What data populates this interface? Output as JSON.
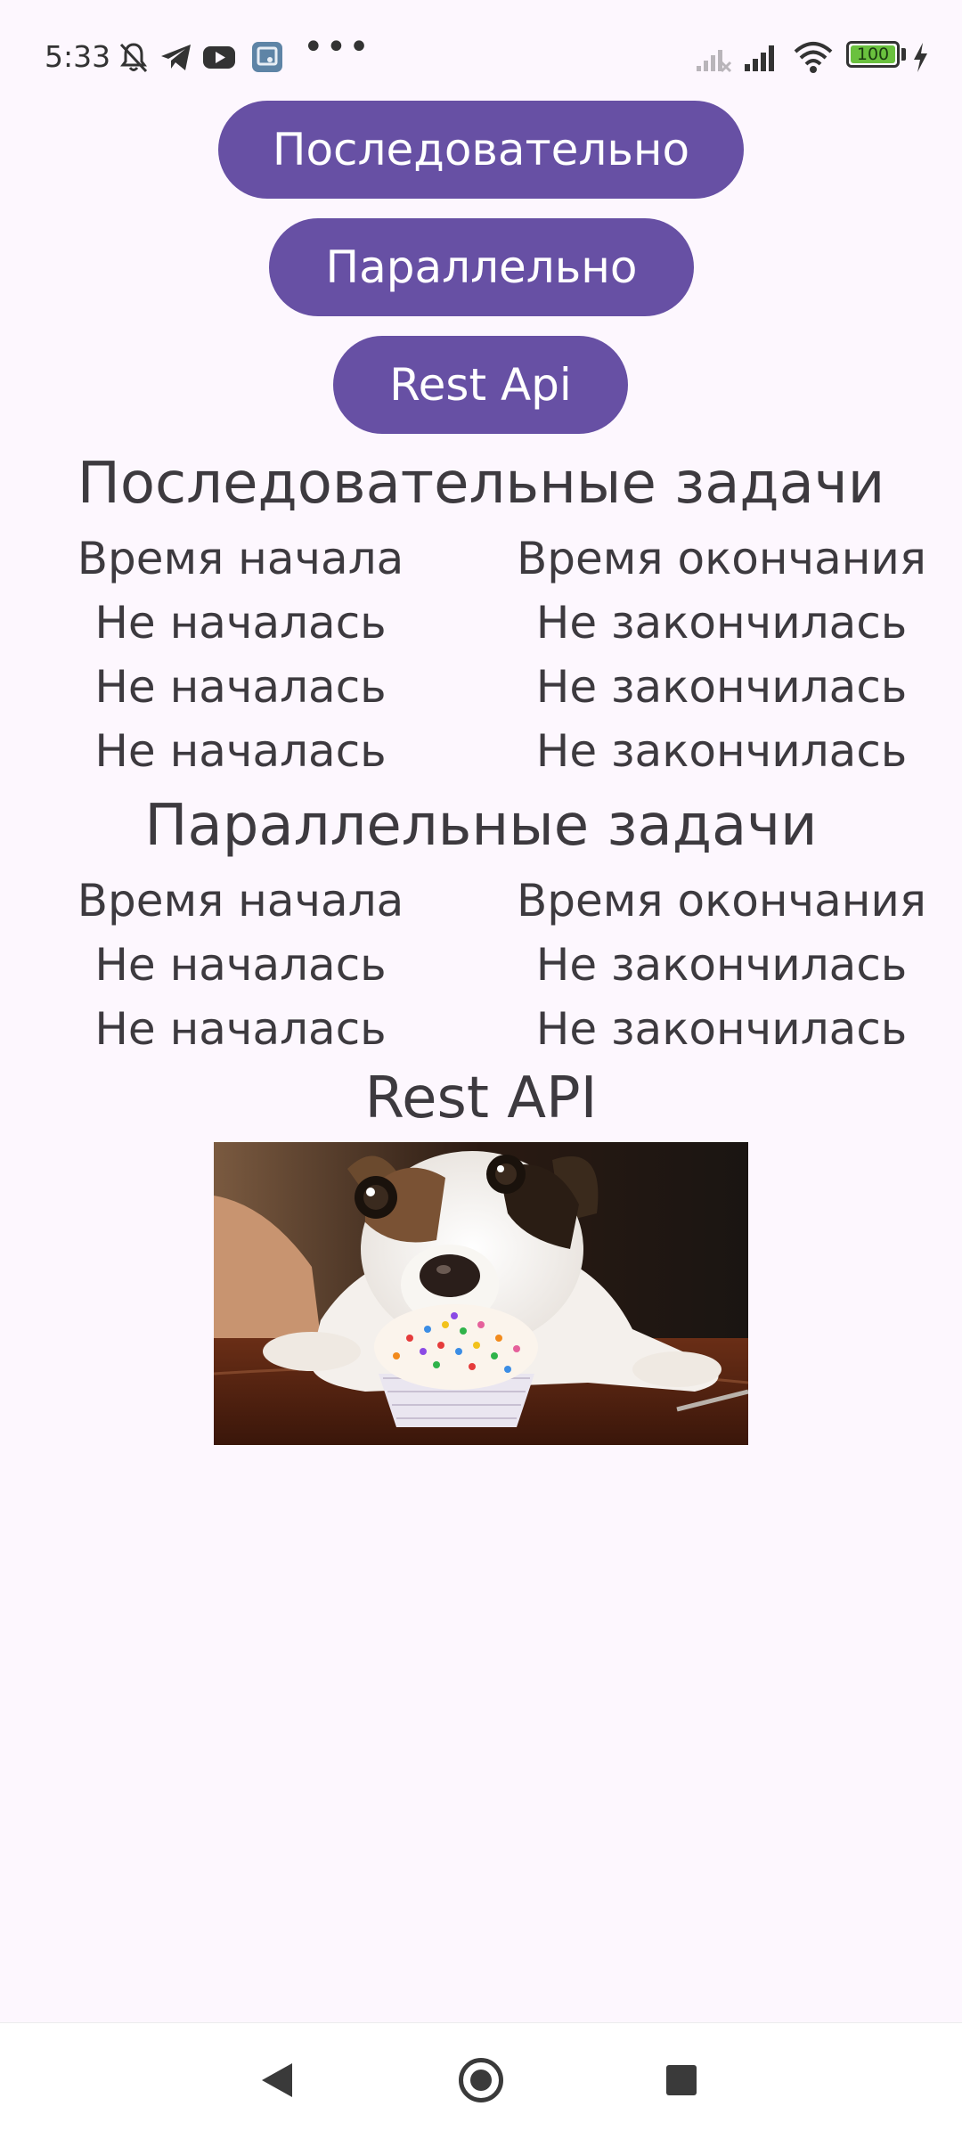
{
  "status_bar": {
    "time": "5:33",
    "battery": "100",
    "battery_level": 1.0,
    "icons": [
      "mute-bell-icon",
      "telegram-icon",
      "youtube-icon",
      "app-icon",
      "more-dots-icon",
      "signal-icon",
      "signal-icon-2",
      "wifi-icon",
      "battery-icon",
      "charging-bolt-icon"
    ],
    "more": "•••"
  },
  "buttons": {
    "sequential": "Последовательно",
    "parallel": "Параллельно",
    "rest": "Rest Api"
  },
  "sequential": {
    "title": "Последовательные задачи",
    "header_start": "Время начала",
    "header_end": "Время окончания",
    "rows": [
      {
        "start": "Не началась",
        "end": "Не закончилась"
      },
      {
        "start": "Не началась",
        "end": "Не закончилась"
      },
      {
        "start": "Не началась",
        "end": "Не закончилась"
      }
    ]
  },
  "parallel": {
    "title": "Параллельные задачи",
    "header_start": "Время начала",
    "header_end": "Время окончания",
    "rows": [
      {
        "start": "Не началась",
        "end": "Не закончилась"
      },
      {
        "start": "Не началась",
        "end": "Не закончилась"
      }
    ]
  },
  "rest": {
    "title": "Rest API"
  },
  "colors": {
    "accent": "#6750a4",
    "background": "#fdf7fe",
    "text": "#3d3a3f"
  }
}
